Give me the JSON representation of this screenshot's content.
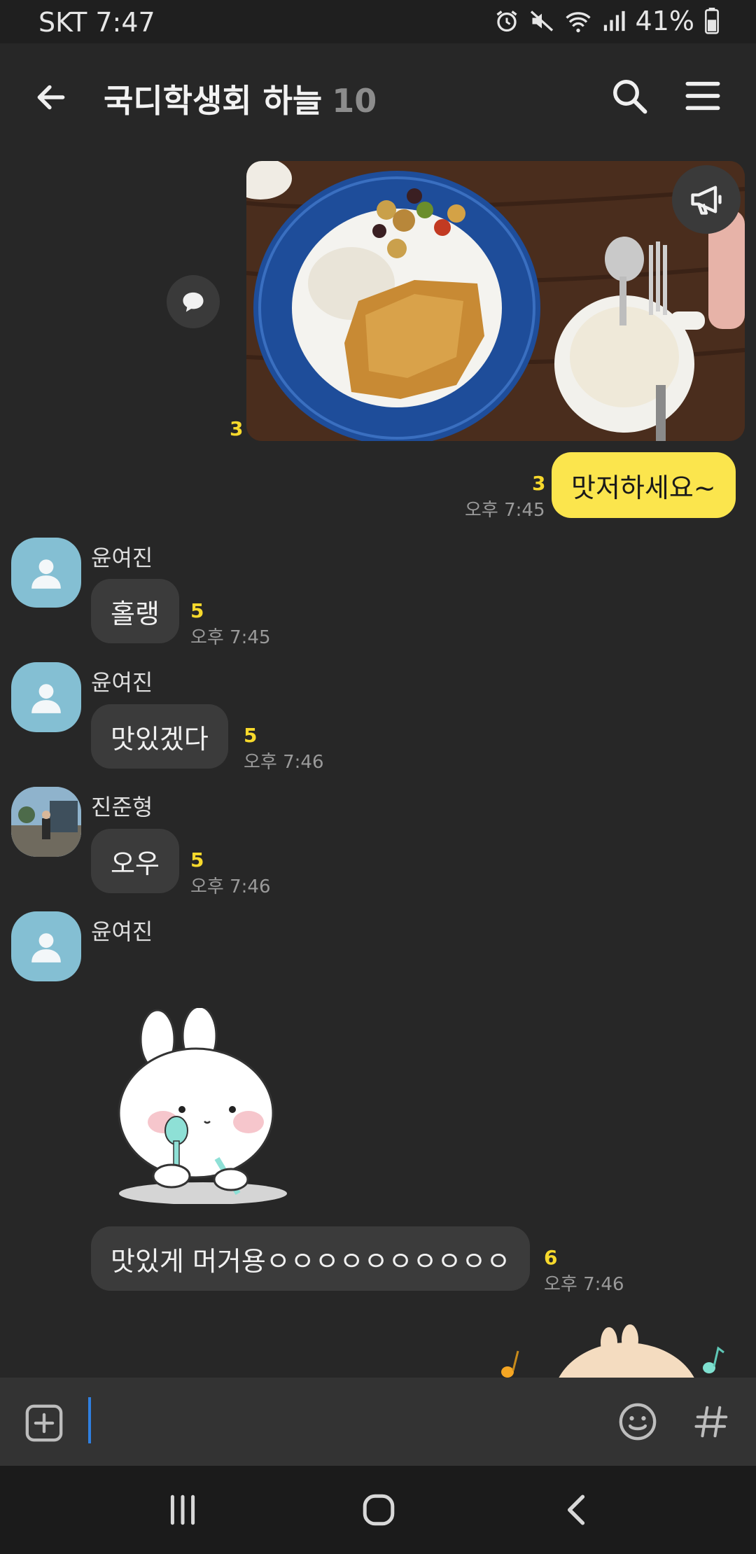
{
  "status_bar": {
    "carrier_time": "SKT 7:47",
    "battery": "41%"
  },
  "header": {
    "title": "국디학생회 하늘",
    "member_count": "10"
  },
  "messages": {
    "photo_unread": "3",
    "mine": {
      "text": "맛저하세요~",
      "unread": "3",
      "time": "오후 7:45"
    },
    "m1": {
      "sender": "윤여진",
      "text": "홀랭",
      "unread": "5",
      "time": "오후 7:45"
    },
    "m2": {
      "sender": "윤여진",
      "text": "맛있겠다",
      "unread": "5",
      "time": "오후 7:46"
    },
    "m3": {
      "sender": "진준형",
      "text": "오우",
      "unread": "5",
      "time": "오후 7:46"
    },
    "m4": {
      "sender": "윤여진",
      "text": "맛있게 머거용ㅇㅇㅇㅇㅇㅇㅇㅇㅇㅇ",
      "unread": "6",
      "time": "오후 7:46"
    }
  },
  "icons": [
    "back-arrow-icon",
    "search-icon",
    "menu-icon",
    "share-icon",
    "megaphone-icon",
    "add-icon",
    "emoji-icon",
    "hash-icon",
    "recents-icon",
    "home-icon",
    "nav-back-icon"
  ],
  "colors": {
    "background": "#272727",
    "my_bubble": "#fbe54d",
    "other_bubble": "#3b3b3b",
    "unread": "#f7d92c",
    "avatar": "#84bfd3"
  }
}
